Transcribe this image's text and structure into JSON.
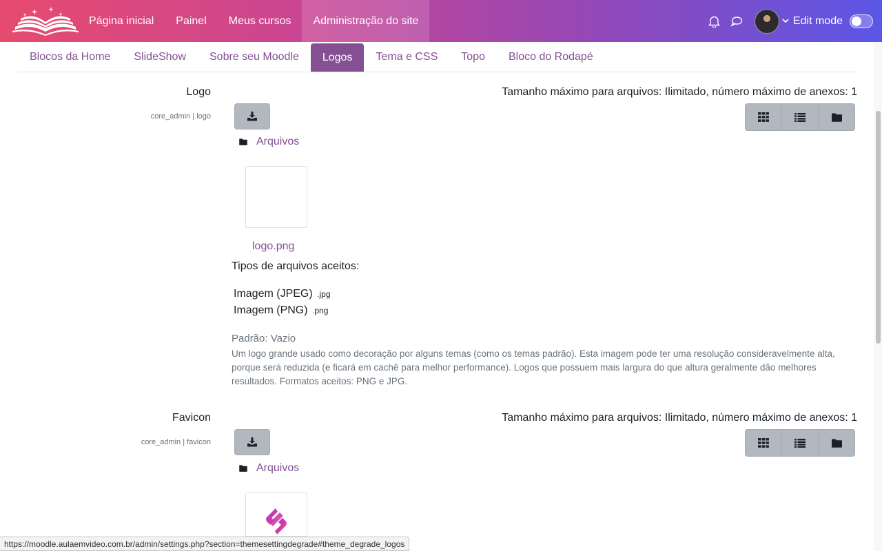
{
  "navbar": {
    "logo_icon": "open-book-logo",
    "items": [
      {
        "label": "Página inicial",
        "active": false
      },
      {
        "label": "Painel",
        "active": false
      },
      {
        "label": "Meus cursos",
        "active": false
      },
      {
        "label": "Administração do site",
        "active": true
      }
    ],
    "notification_icon": "bell-icon",
    "messages_icon": "chat-bubble-icon",
    "edit_mode_label": "Edit mode",
    "edit_mode_on": false
  },
  "tabs": [
    {
      "label": "Blocos da Home",
      "active": false
    },
    {
      "label": "SlideShow",
      "active": false
    },
    {
      "label": "Sobre seu Moodle",
      "active": false
    },
    {
      "label": "Logos",
      "active": true
    },
    {
      "label": "Tema e CSS",
      "active": false
    },
    {
      "label": "Topo",
      "active": false
    },
    {
      "label": "Bloco do Rodapé",
      "active": false
    }
  ],
  "settings": {
    "logo": {
      "label": "Logo",
      "key": "core_admin | logo",
      "max_info": "Tamanho máximo para arquivos: Ilimitado, número máximo de anexos: 1",
      "folder_label": "Arquivos",
      "file_name": "logo.png",
      "accepted_title": "Tipos de arquivos aceitos:",
      "accepted_types": [
        {
          "name": "Imagem (JPEG)",
          "ext": ".jpg"
        },
        {
          "name": "Imagem (PNG)",
          "ext": ".png"
        }
      ],
      "default": "Padrão: Vazio",
      "description": "Um logo grande usado como decoração por alguns temas (como os temas padrão). Esta imagem pode ter uma resolução consideravelmente alta, porque será reduzida (e ficará em cachê para melhor performance). Logos que possuem mais largura do que altura geralmente dão melhores resultados. Formatos aceitos: PNG e JPG."
    },
    "favicon": {
      "label": "Favicon",
      "key": "core_admin | favicon",
      "max_info": "Tamanho máximo para arquivos: Ilimitado, número máximo de anexos: 1",
      "folder_label": "Arquivos"
    }
  },
  "statusbar": {
    "url": "https://moodle.aulaemvideo.com.br/admin/settings.php?section=themesettingdegrade#theme_degrade_logos"
  },
  "colors": {
    "accent": "#844f93",
    "gradient_start": "#e64a6e",
    "gradient_end": "#5b56e6"
  }
}
